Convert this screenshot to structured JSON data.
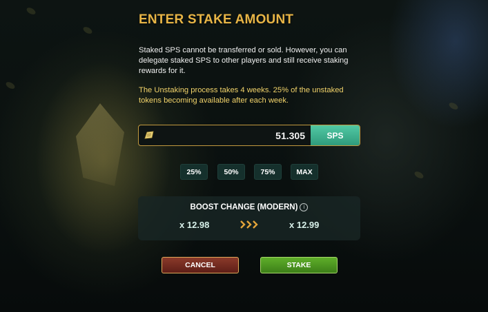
{
  "dialog": {
    "title": "ENTER STAKE AMOUNT",
    "description": "Staked SPS cannot be transferred or sold. However, you can delegate staked SPS to other players and still receive staking rewards for it.",
    "warning": "The Unstaking process takes 4 weeks. 25% of the unstaked tokens becoming available after each week."
  },
  "stake_input": {
    "value": "51.305",
    "unit": "SPS",
    "icon": "sps-token-icon"
  },
  "percent_buttons": [
    "25%",
    "50%",
    "75%",
    "MAX"
  ],
  "boost": {
    "title": "BOOST CHANGE (MODERN)",
    "info_icon": "i",
    "from": "x 12.98",
    "to": "x 12.99",
    "arrow_icon": "triple-chevron-right-icon"
  },
  "buttons": {
    "cancel": "CANCEL",
    "stake": "STAKE"
  },
  "colors": {
    "title": "#e8b546",
    "warning": "#f2d36a",
    "unit_badge": "#3fb28f",
    "cancel": "#6e2a1f",
    "stake": "#4c9620",
    "arrows": "#e3a43a"
  }
}
